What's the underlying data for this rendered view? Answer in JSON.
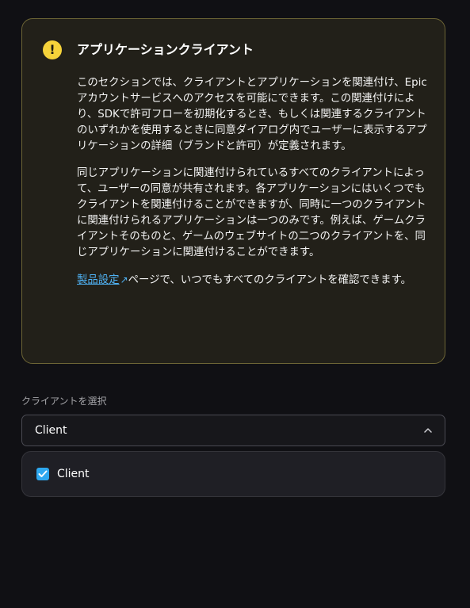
{
  "notice": {
    "icon": "warning-icon",
    "icon_glyph": "!",
    "title": "アプリケーションクライアント",
    "paragraph1": "このセクションでは、クライアントとアプリケーションを関連付け、Epicアカウントサービスへのアクセスを可能にできます。この関連付けにより、SDKで許可フローを初期化するとき、もしくは関連するクライアントのいずれかを使用するときに同意ダイアログ内でユーザーに表示するアプリケーションの詳細（ブランドと許可）が定義されます。",
    "paragraph2": "同じアプリケーションに関連付けられているすべてのクライアントによって、ユーザーの同意が共有されます。各アプリケーションにはいくつでもクライアントを関連付けることができますが、同時に一つのクライアントに関連付けられるアプリケーションは一つのみです。例えば、ゲームクライアントそのものと、ゲームのウェブサイトの二つのクライアントを、同じアプリケーションに関連付けることができます。",
    "link_text": "製品設定",
    "link_icon": "external-link-icon",
    "link_suffix": "ページで、いつでもすべてのクライアントを確認できます。",
    "accent_color": "#f5d23a",
    "link_color": "#4fb1f2"
  },
  "client_select": {
    "label": "クライアントを選択",
    "value": "Client",
    "expanded": true,
    "options": [
      {
        "label": "Client",
        "checked": true
      }
    ],
    "check_color": "#2ea8ef"
  }
}
